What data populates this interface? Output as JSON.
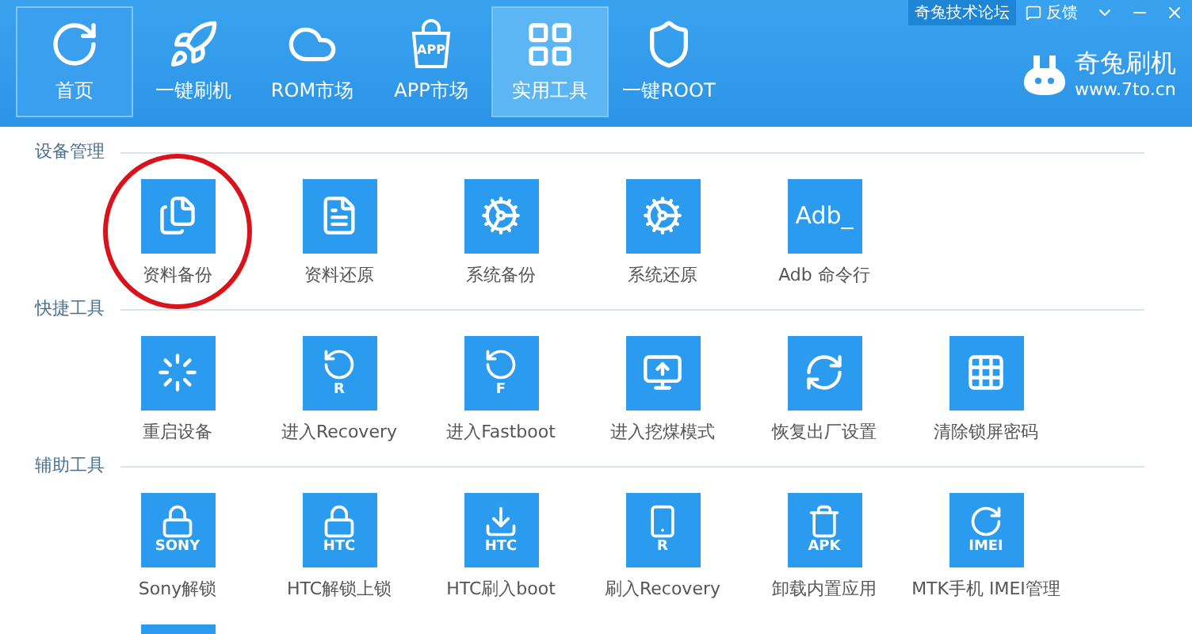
{
  "top_links": [
    {
      "label": "奇兔技术论坛"
    },
    {
      "label": "反馈"
    }
  ],
  "nav": [
    {
      "label": "首页",
      "selected": false,
      "framed": true
    },
    {
      "label": "一键刷机",
      "selected": false,
      "framed": false
    },
    {
      "label": "ROM市场",
      "selected": false,
      "framed": false
    },
    {
      "label": "APP市场",
      "selected": false,
      "framed": false,
      "glyph": "APP"
    },
    {
      "label": "实用工具",
      "selected": true,
      "framed": false
    },
    {
      "label": "一键ROOT",
      "selected": false,
      "framed": false
    }
  ],
  "logo": {
    "name": "奇兔刷机",
    "url": "www.7to.cn"
  },
  "sections": [
    {
      "title": "设备管理",
      "tools": [
        {
          "label": "资料备份",
          "highlighted": true
        },
        {
          "label": "资料还原",
          "highlighted": false
        },
        {
          "label": "系统备份",
          "highlighted": false
        },
        {
          "label": "系统还原",
          "highlighted": false
        },
        {
          "label": "Adb 命令行",
          "highlighted": false,
          "glyph": "Adb_"
        }
      ]
    },
    {
      "title": "快捷工具",
      "tools": [
        {
          "label": "重启设备",
          "highlighted": false
        },
        {
          "label": "进入Recovery",
          "highlighted": false,
          "glyph": "R"
        },
        {
          "label": "进入Fastboot",
          "highlighted": false,
          "glyph": "F"
        },
        {
          "label": "进入挖煤模式",
          "highlighted": false
        },
        {
          "label": "恢复出厂设置",
          "highlighted": false
        },
        {
          "label": "清除锁屏密码",
          "highlighted": false
        }
      ]
    },
    {
      "title": "辅助工具",
      "tools": [
        {
          "label": "Sony解锁",
          "highlighted": false,
          "glyph": "SONY"
        },
        {
          "label": "HTC解锁上锁",
          "highlighted": false,
          "glyph": "HTC"
        },
        {
          "label": "HTC刷入boot",
          "highlighted": false,
          "glyph": "HTC"
        },
        {
          "label": "刷入Recovery",
          "highlighted": false,
          "glyph": "R"
        },
        {
          "label": "卸载内置应用",
          "highlighted": false,
          "glyph": "APK"
        },
        {
          "label": "MTK手机 IMEI管理",
          "highlighted": false,
          "glyph": "IMEI"
        },
        {
          "highlighted": false
        }
      ]
    }
  ]
}
